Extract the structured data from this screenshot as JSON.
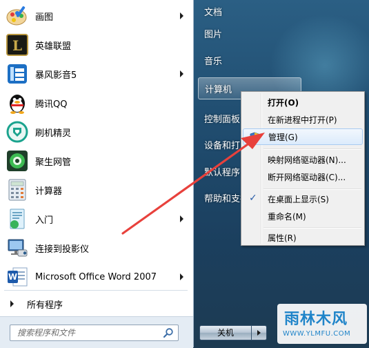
{
  "programs": [
    {
      "label": "画图",
      "icon": "paint-icon",
      "has_submenu": true
    },
    {
      "label": "英雄联盟",
      "icon": "league-of-legends-icon",
      "has_submenu": false
    },
    {
      "label": "暴风影音5",
      "icon": "baofeng-player-icon",
      "has_submenu": true
    },
    {
      "label": "腾讯QQ",
      "icon": "qq-penguin-icon",
      "has_submenu": false
    },
    {
      "label": "刷机精灵",
      "icon": "flash-genie-icon",
      "has_submenu": false
    },
    {
      "label": "聚生网管",
      "icon": "network-manager-icon",
      "has_submenu": false
    },
    {
      "label": "计算器",
      "icon": "calculator-icon",
      "has_submenu": false
    },
    {
      "label": "入门",
      "icon": "getting-started-icon",
      "has_submenu": true
    },
    {
      "label": "连接到投影仪",
      "icon": "projector-icon",
      "has_submenu": false
    },
    {
      "label": "Microsoft Office Word 2007",
      "icon": "word-icon",
      "has_submenu": true
    }
  ],
  "all_programs": {
    "label": "所有程序"
  },
  "search": {
    "placeholder": "搜索程序和文件"
  },
  "places": [
    {
      "label": "文档"
    },
    {
      "label": "图片"
    },
    {
      "label": "音乐"
    },
    {
      "label": "计算机",
      "selected": true
    },
    {
      "label": "控制面板"
    },
    {
      "label": "设备和打印机"
    },
    {
      "label": "默认程序"
    },
    {
      "label": "帮助和支持"
    }
  ],
  "shutdown": {
    "label": "关机"
  },
  "context_menu": {
    "items": [
      {
        "label": "打开(O)",
        "bold": true
      },
      {
        "label": "在新进程中打开(P)"
      },
      {
        "label": "管理(G)",
        "icon": "shield-uac-icon",
        "hover": true
      },
      {
        "label": "映射网络驱动器(N)..."
      },
      {
        "label": "断开网络驱动器(C)..."
      },
      {
        "label": "在桌面上显示(S)",
        "checked": true
      },
      {
        "label": "重命名(M)"
      },
      {
        "label": "属性(R)"
      }
    ],
    "check_mark": "✓"
  },
  "watermark": {
    "title": "雨林木风",
    "url": "WWW.YLMFU.COM"
  },
  "colors": {
    "start_menu_right": "#204d70",
    "annotation_arrow": "#e8413c",
    "menu_hover_border": "#a8cbf1",
    "watermark_text": "#1f84c9"
  }
}
